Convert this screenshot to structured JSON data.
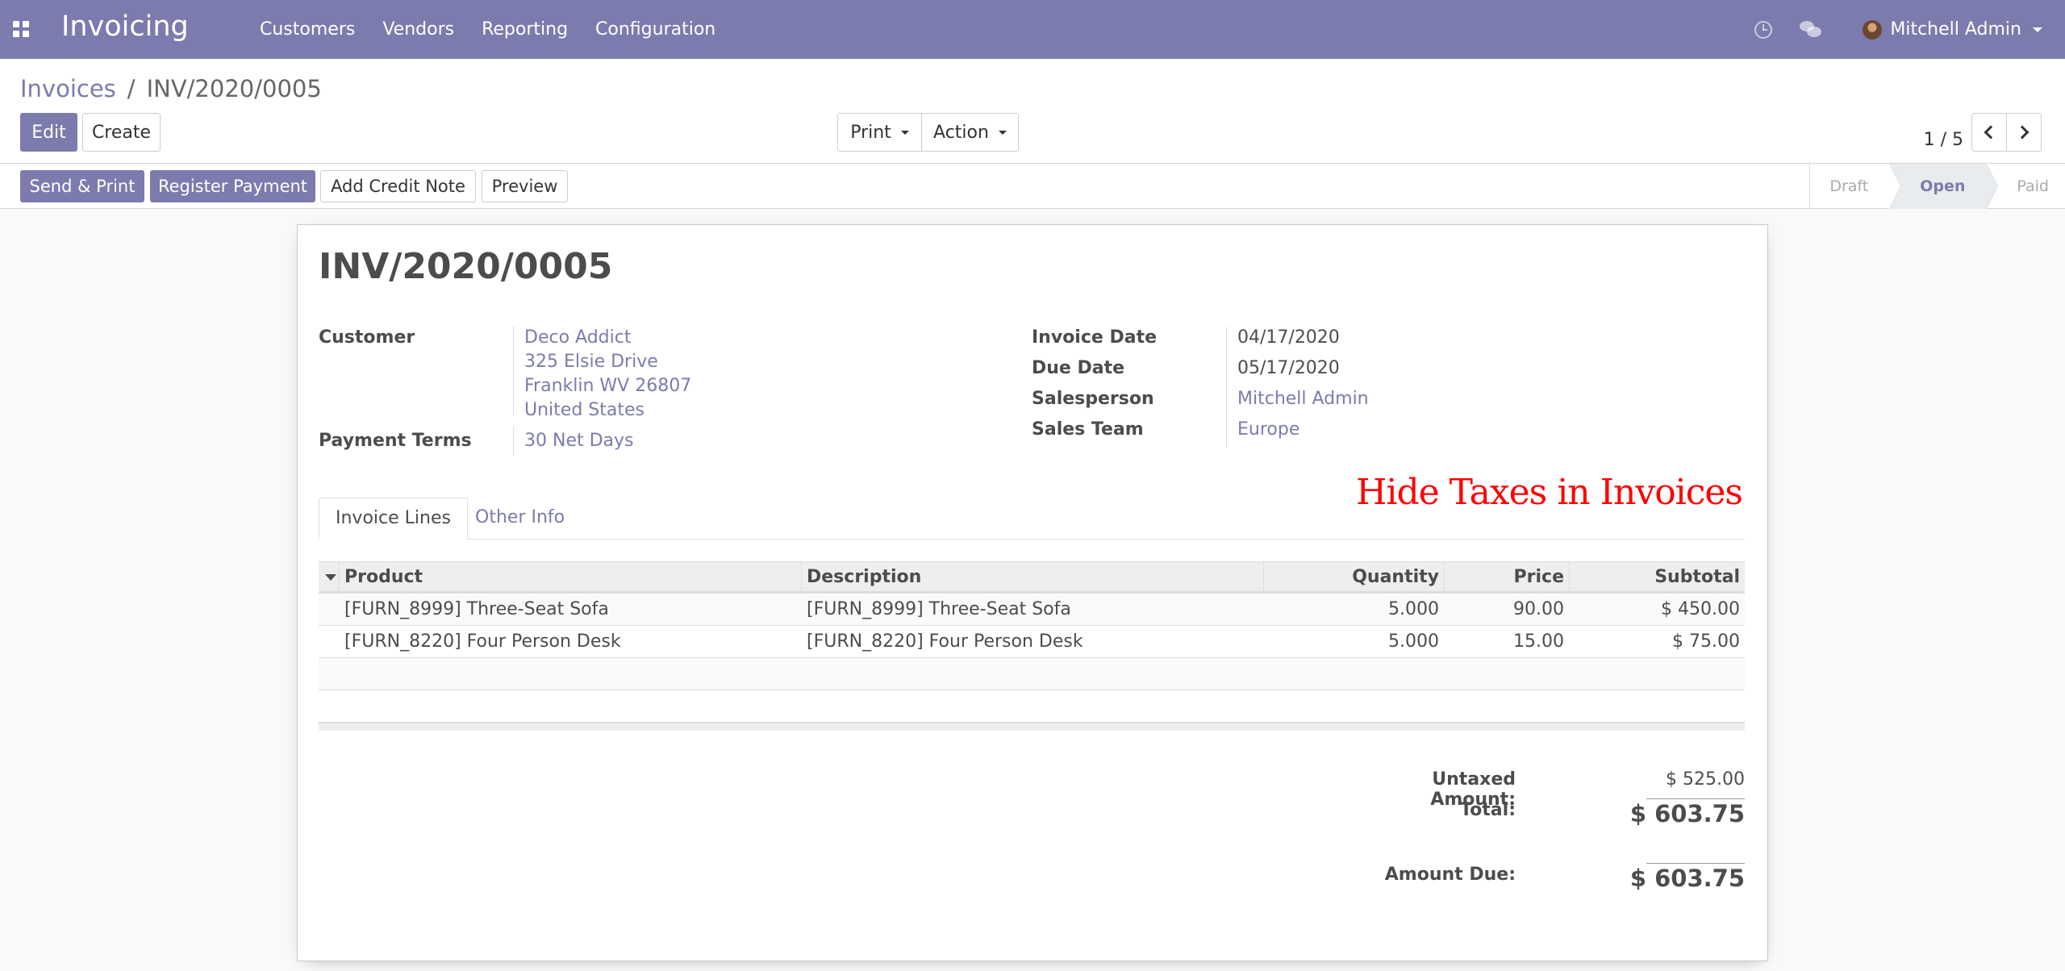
{
  "navbar": {
    "app_title": "Invoicing",
    "menu": [
      "Customers",
      "Vendors",
      "Reporting",
      "Configuration"
    ],
    "user_name": "Mitchell Admin"
  },
  "control_panel": {
    "breadcrumb_parent": "Invoices",
    "breadcrumb_separator": "/",
    "breadcrumb_current": "INV/2020/0005",
    "edit_label": "Edit",
    "create_label": "Create",
    "print_label": "Print",
    "action_label": "Action",
    "pager": "1 / 5"
  },
  "status_bar": {
    "send_print_label": "Send & Print",
    "register_payment_label": "Register Payment",
    "add_credit_note_label": "Add Credit Note",
    "preview_label": "Preview",
    "stages": [
      "Draft",
      "Open",
      "Paid"
    ],
    "active_stage": "Open"
  },
  "invoice": {
    "title": "INV/2020/0005",
    "customer_label": "Customer",
    "customer_name": "Deco Addict",
    "customer_address": [
      "325 Elsie Drive",
      "Franklin WV 26807",
      "United States"
    ],
    "payment_terms_label": "Payment Terms",
    "payment_terms": "30 Net Days",
    "invoice_date_label": "Invoice Date",
    "invoice_date": "04/17/2020",
    "due_date_label": "Due Date",
    "due_date": "05/17/2020",
    "salesperson_label": "Salesperson",
    "salesperson": "Mitchell Admin",
    "sales_team_label": "Sales Team",
    "sales_team": "Europe",
    "annotation": "Hide Taxes in Invoices",
    "tabs": [
      "Invoice Lines",
      "Other Info"
    ],
    "columns": [
      "Product",
      "Description",
      "Quantity",
      "Price",
      "Subtotal"
    ],
    "lines": [
      {
        "product": "[FURN_8999] Three-Seat Sofa",
        "description": "[FURN_8999] Three-Seat Sofa",
        "quantity": "5.000",
        "price": "90.00",
        "subtotal": "$ 450.00"
      },
      {
        "product": "[FURN_8220] Four Person Desk",
        "description": "[FURN_8220] Four Person Desk",
        "quantity": "5.000",
        "price": "15.00",
        "subtotal": "$ 75.00"
      }
    ],
    "untaxed_label": "Untaxed Amount:",
    "untaxed_value": "$ 525.00",
    "total_label": "Total:",
    "total_value": "$ 603.75",
    "amount_due_label": "Amount Due:",
    "amount_due_value": "$ 603.75"
  },
  "colors": {
    "brand": "#7c7bad",
    "annotation": "#ff0000"
  }
}
